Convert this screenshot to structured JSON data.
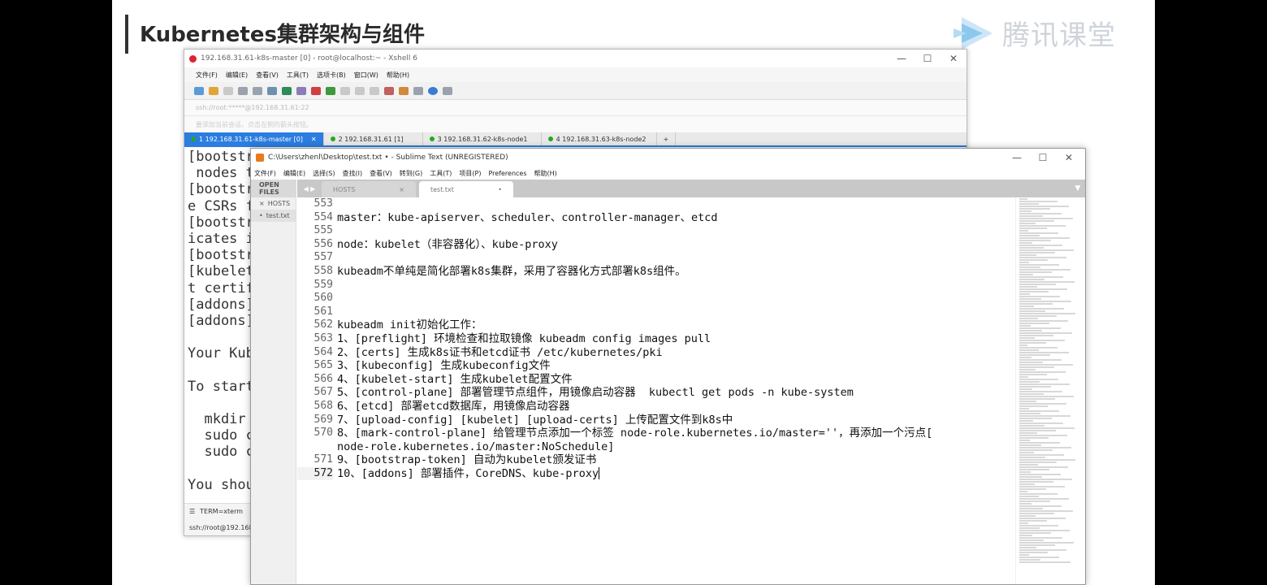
{
  "slide": {
    "title": "Kubernetes集群架构与组件",
    "logo_text": "腾讯课堂"
  },
  "xshell": {
    "title": "192.168.31.61-k8s-master [0] - root@localhost:~ - Xshell 6",
    "menu": [
      "文件(F)",
      "编辑(E)",
      "查看(V)",
      "工具(T)",
      "选项卡(B)",
      "窗口(W)",
      "帮助(H)"
    ],
    "address": "ssh://root:*****@192.168.31.61:22",
    "notice": "要添加当前会话，点击左侧的箭头按钮。",
    "tabs": [
      {
        "label": "1 192.168.31.61-k8s-master [0]",
        "active": true
      },
      {
        "label": "2 192.168.31.61 [1]",
        "active": false
      },
      {
        "label": "3 192.168.31.62-k8s-node1",
        "active": false
      },
      {
        "label": "4 192.168.31.63-k8s-node2",
        "active": false
      }
    ],
    "terminal_lines": [
      "[bootstr",
      " nodes t",
      "[bootstr",
      "e CSRs f",
      "[bootstr",
      "icates i",
      "[bootstr",
      "[kubelet",
      "t certif",
      "[addons]",
      "[addons]",
      "",
      "Your Kub",
      "",
      "To start",
      "",
      "  mkdir ",
      "  sudo c",
      "  sudo c",
      "",
      "You shou"
    ],
    "status_text": "TERM=xterm",
    "ssh_text": "ssh://root@192.168.3"
  },
  "sublime": {
    "title": "C:\\Users\\zhenl\\Desktop\\test.txt • - Sublime Text (UNREGISTERED)",
    "menu": [
      "文件(F)",
      "编辑(E)",
      "选择(S)",
      "查找(I)",
      "查看(V)",
      "转到(G)",
      "工具(T)",
      "项目(P)",
      "Preferences",
      "帮助(H)"
    ],
    "sidebar_head": "OPEN FILES",
    "open_files": [
      {
        "label": "HOSTS",
        "marker": "×",
        "active": false
      },
      {
        "label": "test.txt",
        "marker": "•",
        "active": true
      }
    ],
    "tabs": [
      {
        "label": "HOSTS",
        "marker": "×",
        "active": false
      },
      {
        "label": "test.txt",
        "marker": "•",
        "active": true
      }
    ],
    "lines": [
      {
        "num": "553",
        "text": ""
      },
      {
        "num": "554",
        "text": "master：kube-apiserver、scheduler、controller-manager、etcd"
      },
      {
        "num": "555",
        "text": ""
      },
      {
        "num": "556",
        "text": "node：kubelet（非容器化）、kube-proxy"
      },
      {
        "num": "557",
        "text": ""
      },
      {
        "num": "558",
        "text": "kubeadm不单纯是简化部署k8s集群，采用了容器化方式部署k8s组件。"
      },
      {
        "num": "559",
        "text": ""
      },
      {
        "num": "560",
        "text": ""
      },
      {
        "num": "561",
        "text": ""
      },
      {
        "num": "562",
        "text": "kubeadm init初始化工作："
      },
      {
        "num": "563",
        "text": "1、[preflight] 环境检查和拉取镜像 kubeadm config images pull"
      },
      {
        "num": "564",
        "text": "2、[certs] 生成k8s证书和etcd证书 /etc/kubernetes/pki"
      },
      {
        "num": "565",
        "text": "3、[kubeconfig] 生成kubeconfig文件"
      },
      {
        "num": "566",
        "text": "4、[kubelet-start] 生成kubelet配置文件"
      },
      {
        "num": "567",
        "text": "5、[control-plane] 部署管理节点组件，用镜像启动容器  kubectl get pods -n kube-system"
      },
      {
        "num": "568",
        "text": "6、[etcd] 部署etcd数据库，用镜像启动容器"
      },
      {
        "num": "569",
        "text": "7、[upload-config] [kubelet] [upload-certs] 上传配置文件到k8s中"
      },
      {
        "num": "570",
        "text": "8、[mark-control-plane] 给管理节点添加一个标签 node-role.kubernetes.io/master=''，再添加一个污点["
      },
      {
        "num": "",
        "text": "node-role.kubernetes.io/master:NoSchedule]"
      },
      {
        "num": "571",
        "text": "9、[bootstrap-token] 自动为kubelet颁发证书"
      },
      {
        "num": "572",
        "text": "10、[addons] 部署插件，CoreDNS、kube-proxy"
      }
    ]
  }
}
